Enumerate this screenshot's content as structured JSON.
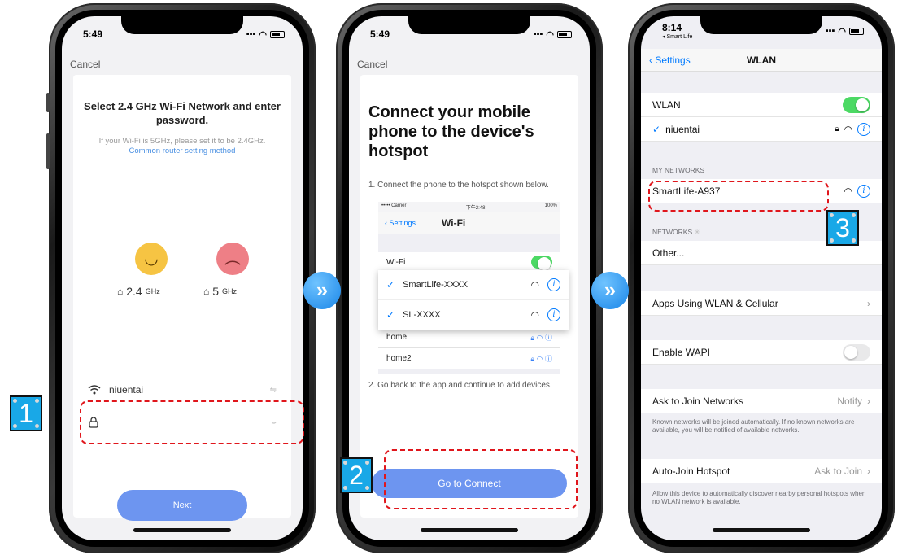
{
  "phone1": {
    "time": "5:49",
    "cancel": "Cancel",
    "title": "Select 2.4 GHz Wi-Fi Network and enter password.",
    "subtitle": "If your Wi-Fi is 5GHz, please set it to be 2.4GHz.",
    "link": "Common router setting method",
    "freq_ok": "2.4",
    "freq_ok_unit": "GHz",
    "freq_bad": "5",
    "freq_bad_unit": "GHz",
    "ssid": "niuentai",
    "password_value": "",
    "next": "Next"
  },
  "phone2": {
    "time": "5:49",
    "cancel": "Cancel",
    "heading": "Connect your mobile phone to the device's hotspot",
    "step1": "1. Connect the phone to the hotspot shown below.",
    "step2": "2. Go back to the app and continue to add devices.",
    "mini": {
      "carrier": "••••• Carrier",
      "time": "下午2:48",
      "battery": "100%",
      "back": "Settings",
      "title": "Wi-Fi",
      "rows": [
        "Wi-Fi",
        "home",
        "home2"
      ]
    },
    "popup": [
      "SmartLife-XXXX",
      "SL-XXXX"
    ],
    "connect": "Go to Connect"
  },
  "phone3": {
    "time": "8:14",
    "back_app": "◂ Smart Life",
    "back": "Settings",
    "title": "WLAN",
    "wlan": "WLAN",
    "current": "niuentai",
    "my_networks": "MY NETWORKS",
    "hotspot": "SmartLife-A937",
    "networks": "NETWORKS",
    "other": "Other...",
    "apps": "Apps Using WLAN & Cellular",
    "wapi": "Enable WAPI",
    "ask": "Ask to Join Networks",
    "ask_value": "Notify",
    "ask_foot": "Known networks will be joined automatically. If no known networks are available, you will be notified of available networks.",
    "auto": "Auto-Join Hotspot",
    "auto_value": "Ask to Join",
    "auto_foot": "Allow this device to automatically discover nearby personal hotspots when no WLAN network is available."
  },
  "badges": [
    "1",
    "2",
    "3"
  ],
  "arrow": "»",
  "colors": {
    "accent": "#6d95f0",
    "ios_blue": "#007aff",
    "badge": "#19a8e7",
    "dash": "#e0161c",
    "toggle_on": "#4cd964"
  }
}
